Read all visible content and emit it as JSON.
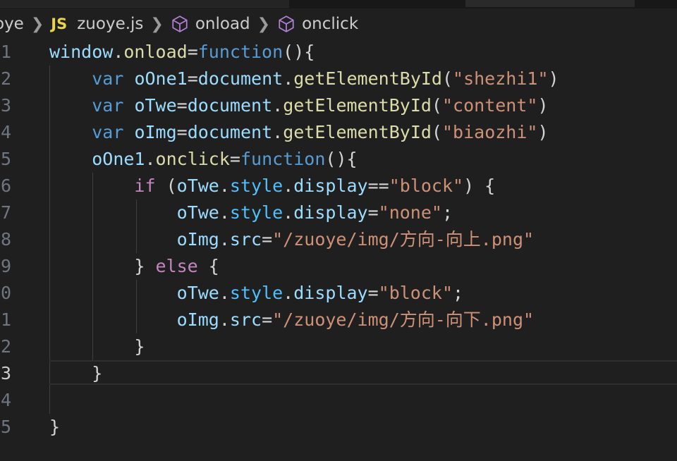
{
  "breadcrumb": {
    "folder": "oye",
    "file_badge": "JS",
    "file": "zuoye.js",
    "symbol1": "onload",
    "symbol2": "onclick"
  },
  "editor": {
    "current_line": 13,
    "lines": [
      {
        "num": "1",
        "tokens": [
          {
            "t": "window",
            "c": "id"
          },
          {
            "t": ".",
            "c": "pun"
          },
          {
            "t": "onload",
            "c": "fn"
          },
          {
            "t": "=",
            "c": "pun"
          },
          {
            "t": "function",
            "c": "kw"
          },
          {
            "t": "(){",
            "c": "pun"
          }
        ]
      },
      {
        "num": "2",
        "tokens": [
          {
            "t": "    ",
            "c": "pun"
          },
          {
            "t": "var",
            "c": "kw"
          },
          {
            "t": " ",
            "c": "pun"
          },
          {
            "t": "oOne1",
            "c": "id"
          },
          {
            "t": "=",
            "c": "pun"
          },
          {
            "t": "document",
            "c": "id"
          },
          {
            "t": ".",
            "c": "pun"
          },
          {
            "t": "getElementById",
            "c": "fn"
          },
          {
            "t": "(",
            "c": "pun"
          },
          {
            "t": "\"shezhi1\"",
            "c": "str"
          },
          {
            "t": ")",
            "c": "pun"
          }
        ]
      },
      {
        "num": "3",
        "tokens": [
          {
            "t": "    ",
            "c": "pun"
          },
          {
            "t": "var",
            "c": "kw"
          },
          {
            "t": " ",
            "c": "pun"
          },
          {
            "t": "oTwe",
            "c": "id"
          },
          {
            "t": "=",
            "c": "pun"
          },
          {
            "t": "document",
            "c": "id"
          },
          {
            "t": ".",
            "c": "pun"
          },
          {
            "t": "getElementById",
            "c": "fn"
          },
          {
            "t": "(",
            "c": "pun"
          },
          {
            "t": "\"content\"",
            "c": "str"
          },
          {
            "t": ")",
            "c": "pun"
          }
        ]
      },
      {
        "num": "4",
        "tokens": [
          {
            "t": "    ",
            "c": "pun"
          },
          {
            "t": "var",
            "c": "kw"
          },
          {
            "t": " ",
            "c": "pun"
          },
          {
            "t": "oImg",
            "c": "id"
          },
          {
            "t": "=",
            "c": "pun"
          },
          {
            "t": "document",
            "c": "id"
          },
          {
            "t": ".",
            "c": "pun"
          },
          {
            "t": "getElementById",
            "c": "fn"
          },
          {
            "t": "(",
            "c": "pun"
          },
          {
            "t": "\"biaozhi\"",
            "c": "str"
          },
          {
            "t": ")",
            "c": "pun"
          }
        ]
      },
      {
        "num": "5",
        "tokens": [
          {
            "t": "    ",
            "c": "pun"
          },
          {
            "t": "oOne1",
            "c": "id"
          },
          {
            "t": ".",
            "c": "pun"
          },
          {
            "t": "onclick",
            "c": "fn"
          },
          {
            "t": "=",
            "c": "pun"
          },
          {
            "t": "function",
            "c": "kw"
          },
          {
            "t": "(){",
            "c": "pun"
          }
        ]
      },
      {
        "num": "6",
        "tokens": [
          {
            "t": "        ",
            "c": "pun"
          },
          {
            "t": "if",
            "c": "ctrl"
          },
          {
            "t": " (",
            "c": "pun"
          },
          {
            "t": "oTwe",
            "c": "id"
          },
          {
            "t": ".",
            "c": "pun"
          },
          {
            "t": "style",
            "c": "prop"
          },
          {
            "t": ".",
            "c": "pun"
          },
          {
            "t": "display",
            "c": "id"
          },
          {
            "t": "==",
            "c": "pun"
          },
          {
            "t": "\"block\"",
            "c": "str"
          },
          {
            "t": ") {",
            "c": "pun"
          }
        ]
      },
      {
        "num": "7",
        "tokens": [
          {
            "t": "            ",
            "c": "pun"
          },
          {
            "t": "oTwe",
            "c": "id"
          },
          {
            "t": ".",
            "c": "pun"
          },
          {
            "t": "style",
            "c": "prop"
          },
          {
            "t": ".",
            "c": "pun"
          },
          {
            "t": "display",
            "c": "id"
          },
          {
            "t": "=",
            "c": "pun"
          },
          {
            "t": "\"none\"",
            "c": "str"
          },
          {
            "t": ";",
            "c": "pun"
          }
        ]
      },
      {
        "num": "8",
        "tokens": [
          {
            "t": "            ",
            "c": "pun"
          },
          {
            "t": "oImg",
            "c": "id"
          },
          {
            "t": ".",
            "c": "pun"
          },
          {
            "t": "src",
            "c": "id"
          },
          {
            "t": "=",
            "c": "pun"
          },
          {
            "t": "\"/zuoye/img/方向-向上.png\"",
            "c": "str"
          }
        ]
      },
      {
        "num": "9",
        "tokens": [
          {
            "t": "        ",
            "c": "pun"
          },
          {
            "t": "} ",
            "c": "pun"
          },
          {
            "t": "else",
            "c": "ctrl"
          },
          {
            "t": " {",
            "c": "pun"
          }
        ]
      },
      {
        "num": "0",
        "tokens": [
          {
            "t": "            ",
            "c": "pun"
          },
          {
            "t": "oTwe",
            "c": "id"
          },
          {
            "t": ".",
            "c": "pun"
          },
          {
            "t": "style",
            "c": "prop"
          },
          {
            "t": ".",
            "c": "pun"
          },
          {
            "t": "display",
            "c": "id"
          },
          {
            "t": "=",
            "c": "pun"
          },
          {
            "t": "\"block\"",
            "c": "str"
          },
          {
            "t": ";",
            "c": "pun"
          }
        ]
      },
      {
        "num": "1",
        "tokens": [
          {
            "t": "            ",
            "c": "pun"
          },
          {
            "t": "oImg",
            "c": "id"
          },
          {
            "t": ".",
            "c": "pun"
          },
          {
            "t": "src",
            "c": "id"
          },
          {
            "t": "=",
            "c": "pun"
          },
          {
            "t": "\"/zuoye/img/方向-向下.png\"",
            "c": "str"
          }
        ]
      },
      {
        "num": "2",
        "tokens": [
          {
            "t": "        ",
            "c": "pun"
          },
          {
            "t": "}",
            "c": "pun"
          }
        ]
      },
      {
        "num": "3",
        "tokens": [
          {
            "t": "    ",
            "c": "pun"
          },
          {
            "t": "}",
            "c": "pun"
          }
        ]
      },
      {
        "num": "4",
        "tokens": []
      },
      {
        "num": "5",
        "tokens": [
          {
            "t": "}",
            "c": "pun"
          }
        ]
      }
    ]
  }
}
